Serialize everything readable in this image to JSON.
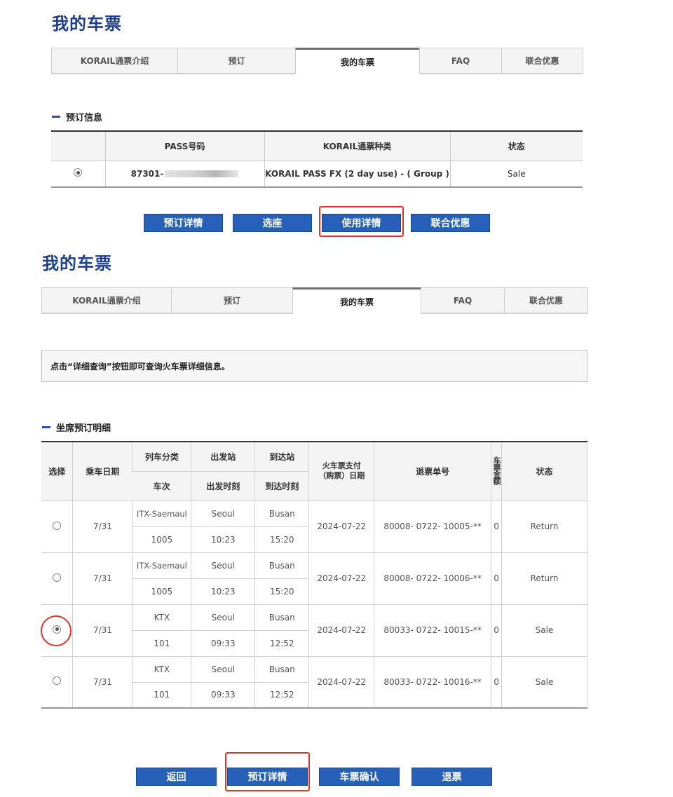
{
  "section1": {
    "title": "我的车票",
    "tabs": [
      "KORAIL通票介绍",
      "预订",
      "我的车票",
      "FAQ",
      "联合优惠"
    ],
    "heading": "预订信息",
    "table": {
      "headers": [
        "PASS号码",
        "KORAIL通票种类",
        "状态"
      ],
      "row": {
        "pass_prefix": "87301-",
        "pass_type": "KORAIL PASS FX (2 day use) - ( Group )",
        "status": "Sale"
      }
    },
    "buttons": [
      "预订详情",
      "选座",
      "使用详情",
      "联合优惠"
    ]
  },
  "section2": {
    "title": "我的车票",
    "tabs": [
      "KORAIL通票介绍",
      "预订",
      "我的车票",
      "FAQ",
      "联合优惠"
    ],
    "notice": "点击“详细查询”按钮即可查询火车票详细信息。",
    "heading": "坐席预订明细",
    "headers": {
      "select": "选择",
      "date": "乘车日期",
      "train_type": "列车分类",
      "train_no": "车次",
      "dep_station": "出发站",
      "dep_time": "出发时刻",
      "arr_station": "到达站",
      "arr_time": "到达时刻",
      "pay_date": "火车票支付（购票）日期",
      "refund_no": "退票单号",
      "amount": "车票金额",
      "status": "状态"
    },
    "rows": [
      {
        "date": "7/31",
        "train_type": "ITX-Saemaul",
        "train_no": "1005",
        "dep_station": "Seoul",
        "dep_time": "10:23",
        "arr_station": "Busan",
        "arr_time": "15:20",
        "pay_date": "2024-07-22",
        "refund_no": "80008- 0722- 10005-**",
        "amount": "0",
        "status": "Return"
      },
      {
        "date": "7/31",
        "train_type": "ITX-Saemaul",
        "train_no": "1005",
        "dep_station": "Seoul",
        "dep_time": "10:23",
        "arr_station": "Busan",
        "arr_time": "15:20",
        "pay_date": "2024-07-22",
        "refund_no": "80008- 0722- 10006-**",
        "amount": "0",
        "status": "Return"
      },
      {
        "date": "7/31",
        "train_type": "KTX",
        "train_no": "101",
        "dep_station": "Seoul",
        "dep_time": "09:33",
        "arr_station": "Busan",
        "arr_time": "12:52",
        "pay_date": "2024-07-22",
        "refund_no": "80033- 0722- 10015-**",
        "amount": "0",
        "status": "Sale"
      },
      {
        "date": "7/31",
        "train_type": "KTX",
        "train_no": "101",
        "dep_station": "Seoul",
        "dep_time": "09:33",
        "arr_station": "Busan",
        "arr_time": "12:52",
        "pay_date": "2024-07-22",
        "refund_no": "80033- 0722- 10016-**",
        "amount": "0",
        "status": "Sale"
      }
    ],
    "buttons": [
      "返回",
      "预订详情",
      "车票确认",
      "退票"
    ]
  },
  "colors": {
    "title": "#1f3f88",
    "button": "#2660b8",
    "highlight": "#e0352b"
  }
}
